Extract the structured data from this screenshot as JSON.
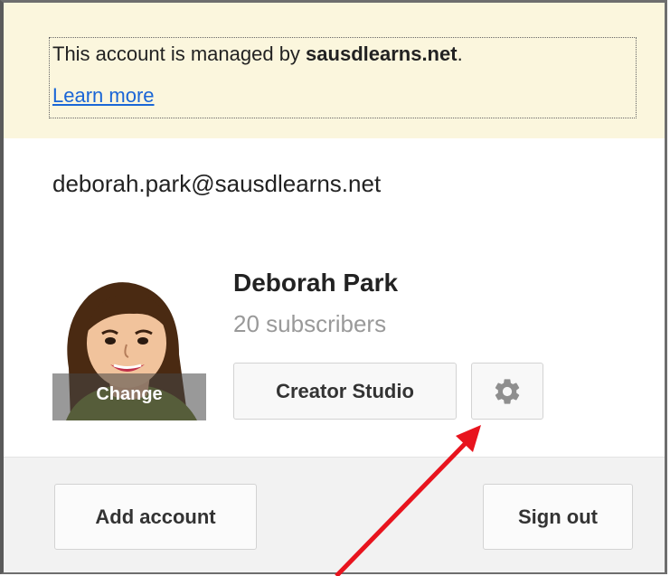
{
  "notice": {
    "text_prefix": "This account is managed by ",
    "domain": "sausdlearns.net",
    "text_suffix": ".",
    "learn_more": "Learn more"
  },
  "account": {
    "email": "deborah.park@sausdlearns.net",
    "name": "Deborah Park",
    "subscribers": "20 subscribers",
    "avatar_change_label": "Change"
  },
  "actions": {
    "creator_studio": "Creator Studio",
    "settings_icon": "gear-icon",
    "add_account": "Add account",
    "sign_out": "Sign out"
  },
  "colors": {
    "notice_bg": "#fbf6dd",
    "link": "#1a66d6",
    "annotation_red": "#e8141e",
    "footer_bg": "#f2f2f2"
  }
}
